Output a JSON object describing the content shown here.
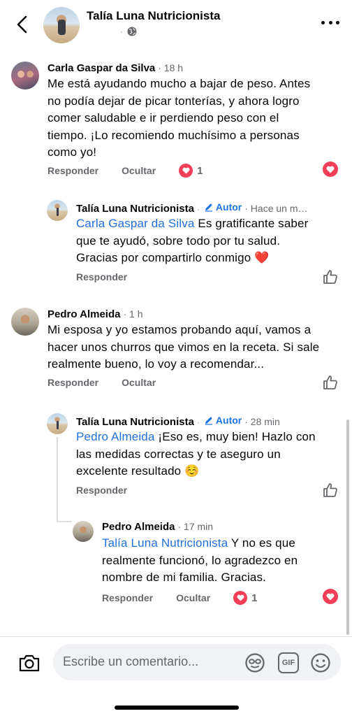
{
  "header": {
    "title": "Talía Luna Nutricionista",
    "dot": "·"
  },
  "comments": [
    {
      "name": "Carla Gaspar da Silva",
      "time": "· 18 h",
      "lines": [
        "Me está ayudando mucho a bajar de peso. Antes",
        "no podía dejar de picar tonterías, y ahora logro",
        "comer saludable e ir perdiendo peso con el",
        "tiempo. ¡Lo recomiendo muchísimo a personas",
        "como yo!"
      ],
      "reply_label": "Responder",
      "hide_label": "Ocultar",
      "reaction_count": "1"
    },
    {
      "name": "Talía Luna Nutricionista",
      "author_label": "Autor",
      "time": "· Hace un m…",
      "mention": "Carla Gaspar da Silva",
      "lines": [
        " Es gratificante saber",
        "que te ayudó, sobre todo por tu salud.",
        "Gracias por compartirlo conmigo ❤️"
      ],
      "reply_label": "Responder"
    },
    {
      "name": "Pedro Almeida",
      "time": "· 1 h",
      "lines": [
        "Mi esposa y yo estamos probando aquí, vamos a",
        "hacer unos churros que vimos en la receta. Si sale",
        "realmente bueno, lo voy a recomendar..."
      ],
      "reply_label": "Responder",
      "hide_label": "Ocultar"
    },
    {
      "name": "Talía Luna Nutricionista",
      "author_label": "Autor",
      "time": "· 28 min",
      "mention": "Pedro Almeida",
      "lines": [
        " ¡Eso es, muy bien! Hazlo con",
        "las medidas correctas y te aseguro un",
        "excelente resultado ☺️"
      ],
      "reply_label": "Responder"
    },
    {
      "name": "Pedro Almeida",
      "time": "· 17 min",
      "mention": "Talía Luna Nutricionista",
      "lines": [
        " Y no es que",
        "realmente funcionó, lo agradezco en",
        "nombre de mi familia. Gracias."
      ],
      "reply_label": "Responder",
      "hide_label": "Ocultar",
      "reaction_count": "1"
    }
  ],
  "composer": {
    "placeholder": "Escribe un comentario...",
    "gif_label": "GIF"
  },
  "icons": {
    "back": "chevron-left-icon",
    "more": "more-horizontal-icon",
    "globe": "globe-icon",
    "camera": "camera-icon",
    "sticker": "sticker-icon",
    "emoji": "emoji-icon",
    "like": "thumbs-up-icon",
    "heart": "heart-icon",
    "pencil": "pencil-icon"
  },
  "colors": {
    "link": "#216fdb",
    "author": "#1b74e4",
    "heart": "#f33e58",
    "secondary_text": "#65676b"
  }
}
